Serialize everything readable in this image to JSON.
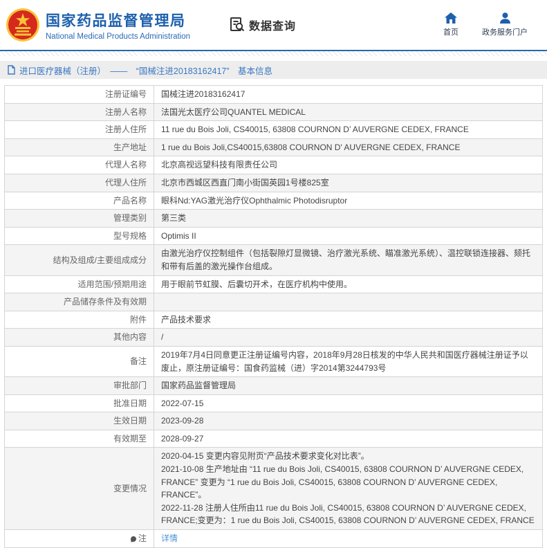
{
  "colors": {
    "brand_blue": "#1d60ac",
    "rule_blue": "#2368b0",
    "link_blue": "#4b94d4",
    "emblem_red": "#d7281e",
    "emblem_gold": "#f7c437",
    "breadcrumb_bg": "#ededed",
    "alt_row_bg": "#f4f4f4"
  },
  "header": {
    "cn_title": "国家药品监督管理局",
    "en_title": "National Medical Products Administration",
    "data_query_label": "数据查询",
    "nav": [
      {
        "label": "首页",
        "icon": "home-icon"
      },
      {
        "label": "政务服务门户",
        "icon": "user-icon"
      }
    ]
  },
  "breadcrumb": {
    "text": "进口医疗器械（注册）　——　“国械注进20183162417”　基本信息"
  },
  "table": {
    "rows": [
      {
        "label": "注册证编号",
        "value": "国械注进20183162417"
      },
      {
        "label": "注册人名称",
        "value": "法国光太医疗公司QUANTEL MEDICAL"
      },
      {
        "label": "注册人住所",
        "value": "11 rue du Bois Joli, CS40015, 63808 COURNON D’ AUVERGNE CEDEX, FRANCE"
      },
      {
        "label": "生产地址",
        "value": "1 rue du Bois Joli,CS40015,63808 COURNON D' AUVERGNE CEDEX, FRANCE"
      },
      {
        "label": "代理人名称",
        "value": "北京高视远望科技有限责任公司"
      },
      {
        "label": "代理人住所",
        "value": "北京市西城区西直门南小街国英园1号楼825室"
      },
      {
        "label": "产品名称",
        "value": "眼科Nd:YAG激光治疗仪Ophthalmic Photodisruptor"
      },
      {
        "label": "管理类别",
        "value": "第三类"
      },
      {
        "label": "型号规格",
        "value": "Optimis II"
      },
      {
        "label": "结构及组成/主要组成成分",
        "value": "由激光治疗仪控制组件（包括裂隙灯显微镜、治疗激光系统、瞄准激光系统）、温控联锁连接器、颏托和带有后盖的激光操作台组成。"
      },
      {
        "label": "适用范围/预期用途",
        "value": "用于眼前节虹膜、后囊切开术，在医疗机构中使用。"
      },
      {
        "label": "产品储存条件及有效期",
        "value": ""
      },
      {
        "label": "附件",
        "value": "产品技术要求"
      },
      {
        "label": "其他内容",
        "value": "/"
      },
      {
        "label": "备注",
        "value": "2019年7月4日同意更正注册证编号内容，2018年9月28日核发的中华人民共和国医疗器械注册证予以废止，原注册证编号：国食药监械（进）字2014第3244793号"
      },
      {
        "label": "审批部门",
        "value": "国家药品监督管理局"
      },
      {
        "label": "批准日期",
        "value": "2022-07-15"
      },
      {
        "label": "生效日期",
        "value": "2023-09-28"
      },
      {
        "label": "有效期至",
        "value": "2028-09-27"
      },
      {
        "label": "变更情况",
        "type": "lines",
        "lines": [
          "2020-04-15 变更内容见附页“产品技术要求变化对比表”。",
          "2021-10-08 生产地址由 “11 rue du Bois Joli, CS40015, 63808 COURNON D’ AUVERGNE CEDEX, FRANCE” 变更为 “1 rue du Bois Joli, CS40015, 63808 COURNON D’ AUVERGNE CEDEX, FRANCE”。",
          "2022-11-28 注册人住所由11 rue du Bois Joli, CS40015, 63808 COURNON D’ AUVERGNE CEDEX, FRANCE;变更为：1 rue du Bois Joli, CS40015, 63808 COURNON D’ AUVERGNE CEDEX, FRANCE"
        ]
      },
      {
        "label": "注",
        "label_icon": "note-icon",
        "type": "link",
        "value": "详情"
      }
    ]
  }
}
